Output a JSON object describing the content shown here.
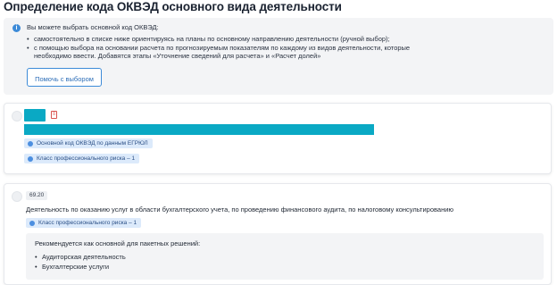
{
  "page": {
    "title": "Определение кода ОКВЭД основного вида деятельности"
  },
  "info": {
    "icon": "info-icon",
    "lead": "Вы можете выбрать основной код ОКВЭД:",
    "items": [
      "самостоятельно в списке ниже ориентируясь на планы по основному направлению деятельности (ручной выбор);",
      "с помощью выбора на основании расчета по прогнозируемым показателям по каждому из видов деятельности, которые необходимо ввести. Добавятся этапы «Уточнение сведений для расчета» и «Расчет долей»"
    ],
    "help_button": "Помочь с выбором"
  },
  "cards": [
    {
      "doc_icon": "document-icon",
      "badges": [
        "Основной код ОКВЭД по данным ЕГРЮЛ",
        "Класс профессионального риска – 1"
      ]
    },
    {
      "code": "69.20",
      "description": "Деятельность по оказанию услуг в области бухгалтерского учета, по проведению финансового аудита, по налоговому консультированию",
      "badge": "Класс профессионального риска – 1",
      "recommend_title": "Рекомендуется как основной для пакетных решений:",
      "recommend_items": [
        "Аудиторская деятельность",
        "Бухгалтерские услуги"
      ]
    }
  ],
  "colors": {
    "accent": "#3d8bd8",
    "redacted": "#0aa9c4",
    "badge_bg": "#dceafb"
  }
}
